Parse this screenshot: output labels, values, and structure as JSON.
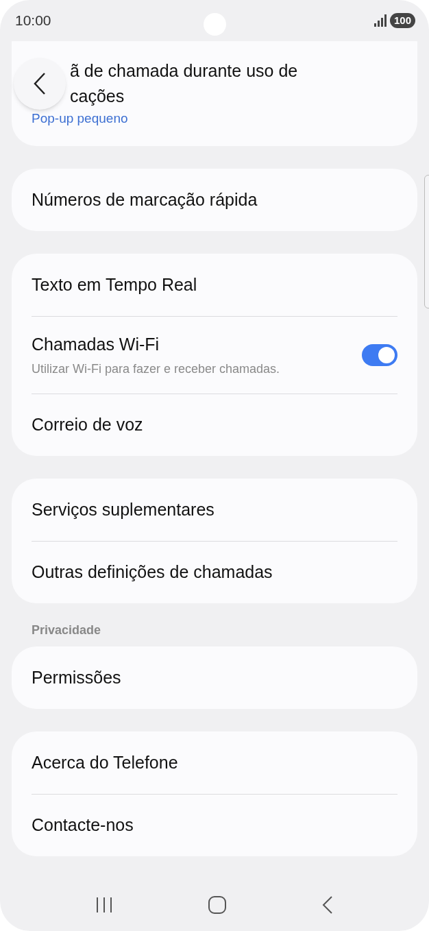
{
  "status_bar": {
    "time": "10:00",
    "battery": "100"
  },
  "groups": [
    {
      "items": [
        {
          "kind": "partial",
          "title_lines": [
            "ã de chamada durante uso de",
            "cações"
          ],
          "summary": "Pop-up pequeno"
        }
      ]
    },
    {
      "items": [
        {
          "kind": "plain",
          "title": "Números de marcação rápida"
        }
      ]
    },
    {
      "items": [
        {
          "kind": "plain",
          "title": "Texto em Tempo Real"
        },
        {
          "kind": "toggle",
          "title": "Chamadas Wi-Fi",
          "subtitle": "Utilizar Wi-Fi para fazer e receber chamadas.",
          "on": true
        },
        {
          "kind": "plain",
          "title": "Correio de voz"
        }
      ]
    },
    {
      "items": [
        {
          "kind": "plain",
          "title": "Serviços suplementares"
        },
        {
          "kind": "plain",
          "title": "Outras definições de chamadas"
        }
      ]
    },
    {
      "header": "Privacidade",
      "items": [
        {
          "kind": "plain",
          "title": "Permissões"
        }
      ]
    },
    {
      "items": [
        {
          "kind": "plain",
          "title": "Acerca do Telefone"
        },
        {
          "kind": "plain",
          "title": "Contacte-nos"
        }
      ]
    }
  ]
}
